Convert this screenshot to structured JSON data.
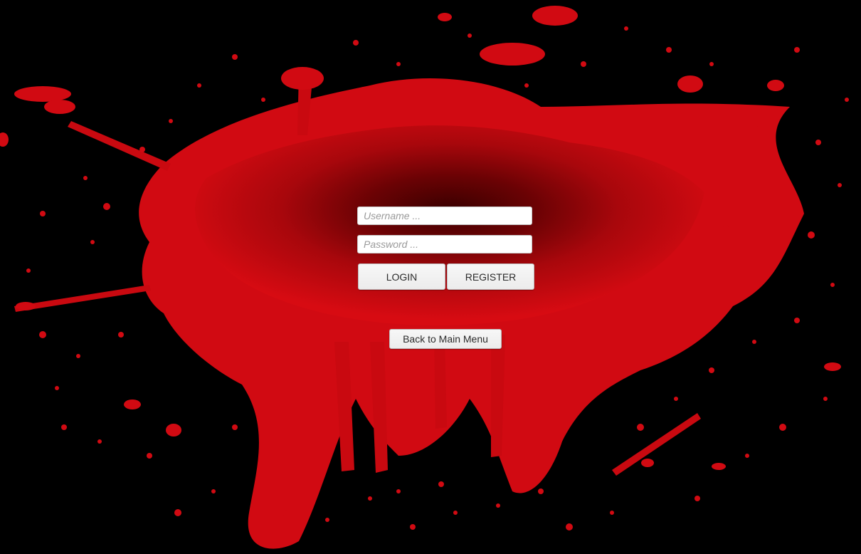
{
  "login_form": {
    "username_placeholder": "Username ...",
    "password_placeholder": "Password ...",
    "login_label": "LOGIN",
    "register_label": "REGISTER"
  },
  "navigation": {
    "back_label": "Back to Main Menu"
  },
  "theme": {
    "background": "#000000",
    "splatter_color": "#d10a12",
    "splatter_dark": "#5a0000"
  }
}
